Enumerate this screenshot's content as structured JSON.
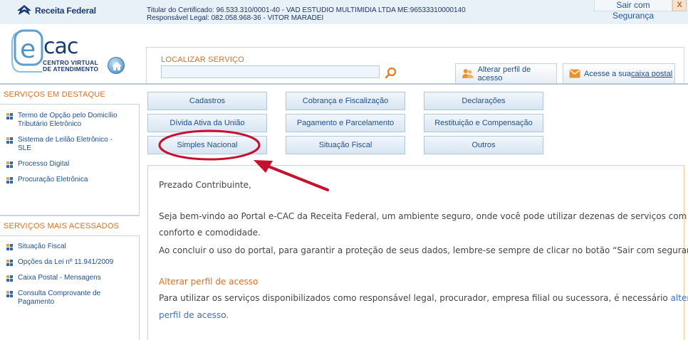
{
  "header": {
    "rf_logo_text": "Receita Federal",
    "certificate_line": "Titular do Certificado: 96.533.310/0001-40 - VAD ESTUDIO MULTIMIDIA LTDA ME:96533310000140",
    "legal_line": "Responsável Legal: 082.058.968-36 - VITOR MARADEI",
    "logout_label": "Sair com Segurança",
    "logout_close": "X",
    "ecac_text": "cac",
    "ecac_e": "e",
    "ecac_sub_1": "CENTRO VIRTUAL",
    "ecac_sub_2": "DE ATENDIMENTO"
  },
  "search": {
    "label": "LOCALIZAR SERVIÇO",
    "value": "",
    "placeholder": ""
  },
  "header_buttons": {
    "perfil_label": "Alterar perfil de acesso",
    "caixa_prefix": "Acesse a sua ",
    "caixa_link": "caixa postal"
  },
  "sidebar": {
    "destaque_title": "SERVIÇOS EM DESTAQUE",
    "destaque_items": [
      "Termo de Opção pelo Domicílio Tributário Eletrônico",
      "Sistema de Leilão Eletrônico - SLE",
      "Processo Digital",
      "Procuração Eletrônica"
    ],
    "acessados_title": "SERVIÇOS MAIS ACESSADOS",
    "acessados_items": [
      "Situação Fiscal",
      "Opções da Lei nº 11.941/2009",
      "Caixa Postal - Mensagens",
      "Consulta Comprovante de Pagamento"
    ]
  },
  "services": {
    "cadastros": "Cadastros",
    "cobranca": "Cobrança e Fiscalização",
    "declaracoes": "Declarações",
    "divida": "Dívida Ativa da União",
    "pagamento": "Pagamento e Parcelamento",
    "restituicao": "Restituição e Compensação",
    "simples": "Simples Nacional",
    "situacao": "Situação Fiscal",
    "outros": "Outros"
  },
  "content": {
    "greeting": "Prezado Contribuinte,",
    "welcome_1": "Seja bem-vindo ao Portal e-CAC da Receita Federal, um ambiente seguro, onde você pode utilizar dezenas de serviços com maior",
    "welcome_2": "conforto e comodidade.",
    "logout_hint": "Ao concluir o uso do portal, para garantir a proteção de seus dados, lembre-se sempre de clicar no botão “Sair com segurança”.",
    "perfil_heading": "Alterar perfil de acesso",
    "perfil_text_1": "Para utilizar os serviços disponibilizados como responsável legal, procurador, empresa filial ou sucessora, é necessário ",
    "perfil_link_1": "alterar o",
    "perfil_link_2": "perfil de acesso",
    "perfil_text_2": "."
  },
  "colors": {
    "accent_orange": "#d9701f",
    "link_blue": "#1f4f8f",
    "annotation_red": "#c8102e"
  }
}
